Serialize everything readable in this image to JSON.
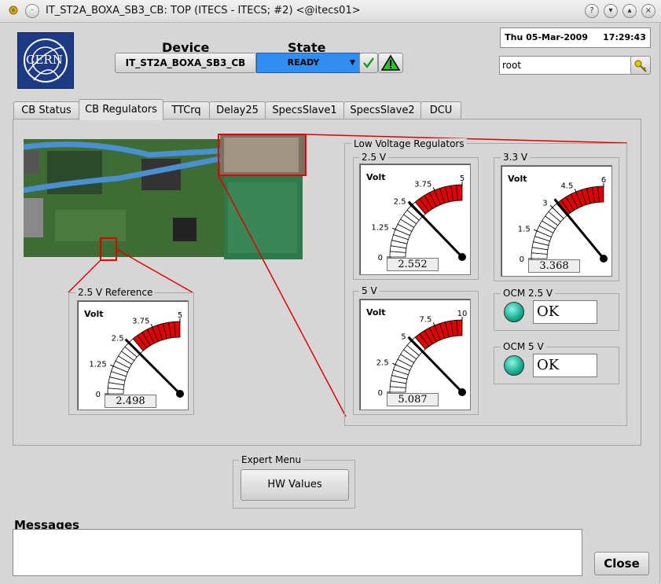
{
  "window": {
    "title": "IT_ST2A_BOXA_SB3_CB: TOP (ITECS - ITECS; #2) <@itecs01>"
  },
  "header": {
    "logo_text": "CERN",
    "device_label": "Device",
    "device_value": "IT_ST2A_BOXA_SB3_CB",
    "state_label": "State",
    "state_value": "READY",
    "datetime": "Thu 05-Mar-2009     17:29:43",
    "user_value": "root"
  },
  "tabs": [
    "CB Status",
    "CB Regulators",
    "TTCrq",
    "Delay25",
    "SpecsSlave1",
    "SpecsSlave2",
    "DCU"
  ],
  "active_tab": "CB Regulators",
  "reference": {
    "group_label": "2.5 V Reference",
    "gauge": {
      "unit": "Volt",
      "ticks": [
        "0",
        "1.25",
        "2.5",
        "3.75",
        "5"
      ],
      "max": 5,
      "value": 2.498,
      "readout": "2.498"
    }
  },
  "lv": {
    "group_label": "Low Voltage Regulators",
    "gauges": [
      {
        "label": "2.5 V",
        "unit": "Volt",
        "ticks": [
          "0",
          "1.25",
          "2.5",
          "3.75",
          "5"
        ],
        "max": 5,
        "value": 2.552,
        "readout": "2.552"
      },
      {
        "label": "3.3 V",
        "unit": "Volt",
        "ticks": [
          "0",
          "1.5",
          "3",
          "4.5",
          "6"
        ],
        "max": 6,
        "value": 3.368,
        "readout": "3.368"
      },
      {
        "label": "5 V",
        "unit": "Volt",
        "ticks": [
          "0",
          "2.5",
          "5",
          "7.5",
          "10"
        ],
        "max": 10,
        "value": 5.087,
        "readout": "5.087"
      }
    ],
    "ocm": [
      {
        "label": "OCM 2.5 V",
        "value": "OK"
      },
      {
        "label": "OCM 5 V",
        "value": "OK"
      }
    ]
  },
  "expert": {
    "group_label": "Expert Menu",
    "hw_button": "HW Values"
  },
  "messages": {
    "label": "Messages"
  },
  "close_button": "Close",
  "colors": {
    "state": "#2f8ef0",
    "danger": "#e00000",
    "led": "#13a98e",
    "logo": "#1f3a85"
  }
}
